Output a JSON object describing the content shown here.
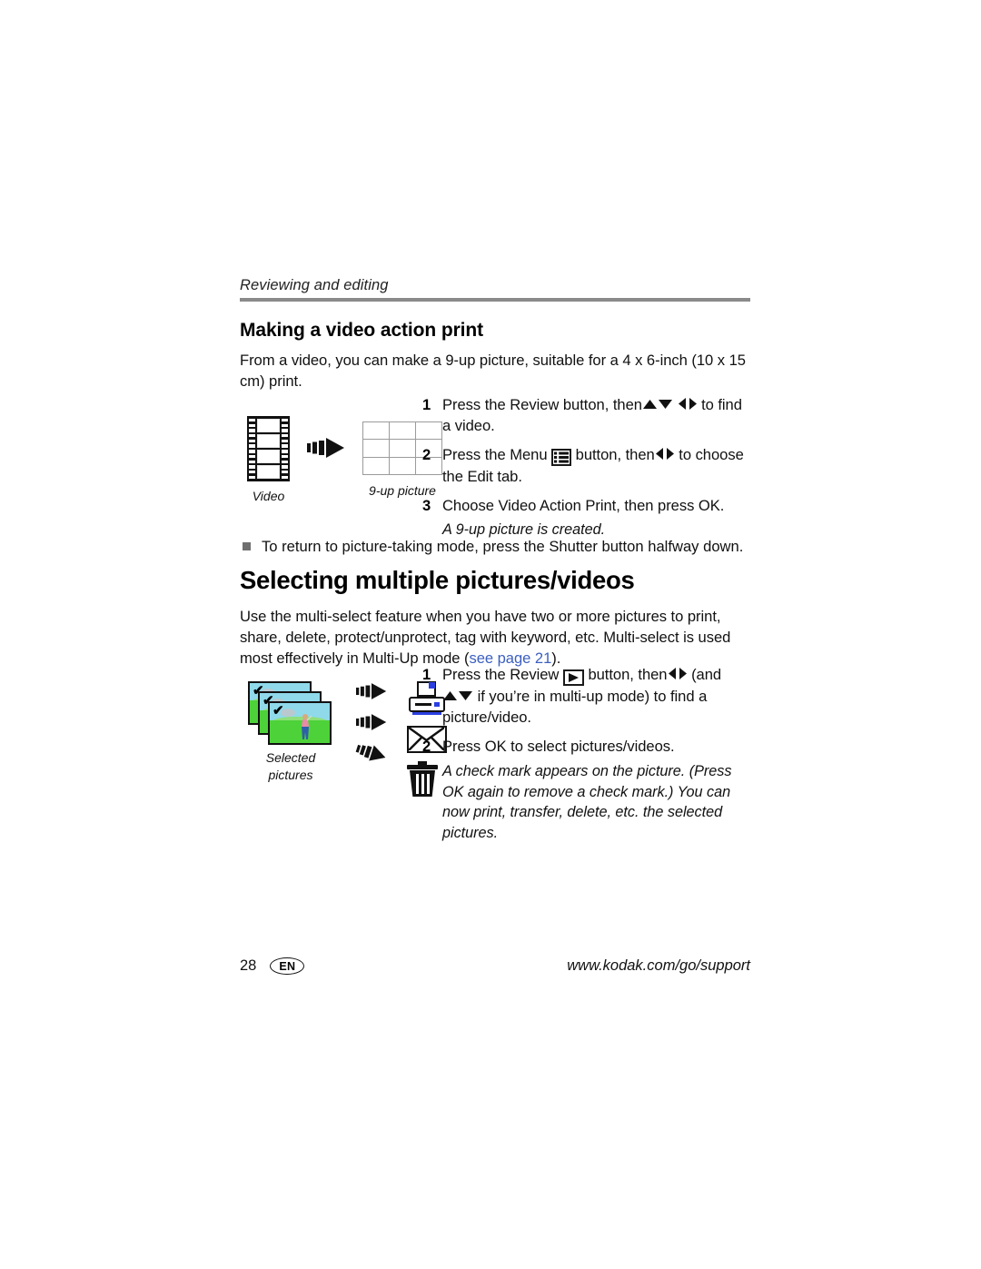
{
  "running_header": "Reviewing and editing",
  "section_video_print": {
    "heading": "Making a video action print",
    "intro": "From a video, you can make a 9-up picture, suitable for a 4 x 6-inch (10 x 15 cm) print.",
    "figure": {
      "left_caption": "Video",
      "right_caption": "9-up picture",
      "left_icon": "filmstrip-icon",
      "arrow_icon": "block-arrow-right-icon",
      "right_icon": "nine-up-grid-icon"
    },
    "steps": [
      {
        "number": "1",
        "text_before": "Press the Review button, then",
        "glyphs": [
          "up-triangle-icon",
          "down-triangle-icon",
          "left-triangle-icon",
          "right-triangle-icon"
        ],
        "text_after": "to find a video."
      },
      {
        "number": "2",
        "text_before": "Press the Menu",
        "inline_icon": "menu-list-icon",
        "text_mid": "button, then",
        "glyphs": [
          "left-triangle-icon",
          "right-triangle-icon"
        ],
        "text_after": "to choose the Edit tab."
      },
      {
        "number": "3",
        "text_before": "Choose Video Action Print, then press OK.",
        "glyphs": [],
        "text_after": ""
      }
    ],
    "note": "A 9-up picture is created.",
    "bullet": "To return to picture-taking mode, press the Shutter button halfway down."
  },
  "section_multi_select": {
    "heading": "Selecting multiple pictures/videos",
    "intro_part1": "Use the multi-select feature when you have two or more pictures to print, share, delete, protect/unprotect, tag with keyword, etc. Multi-select is used most effectively in Multi-Up mode (",
    "intro_link": "see page 21",
    "intro_part2": ").",
    "figure": {
      "caption_line1": "Selected",
      "caption_line2": "pictures",
      "photo_icon": "golf-picture-thumbnail",
      "check_icon": "check-mark-icon",
      "arrow_icon": "block-arrow-right-icon",
      "targets": [
        "printer-icon",
        "envelope-icon",
        "trash-icon"
      ]
    },
    "steps": [
      {
        "number": "1",
        "text_before": "Press the Review",
        "inline_icon": "play-button-icon",
        "text_mid": "button, then",
        "glyphs_1": [
          "left-triangle-icon",
          "right-triangle-icon"
        ],
        "text_paren": "(and",
        "glyphs_2": [
          "up-triangle-icon",
          "down-triangle-icon"
        ],
        "text_after": "if you’re in multi-up mode) to find a picture/video."
      },
      {
        "number": "2",
        "text_before": "Press OK to select pictures/videos.",
        "text_after": ""
      }
    ],
    "note": "A check mark appears on the picture. (Press OK again to remove a check mark.) You can now print, transfer, delete, etc. the selected pictures."
  },
  "footer": {
    "page_number": "28",
    "language_badge": "EN",
    "url": "www.kodak.com/go/support"
  },
  "colors": {
    "rule": "#8a8a8a",
    "link": "#3b5fc0",
    "bullet": "#6f6f6f",
    "printer_accent": "#2b3fe0",
    "photo_sky": "#8fd9ea",
    "photo_grass": "#4ed23a"
  }
}
